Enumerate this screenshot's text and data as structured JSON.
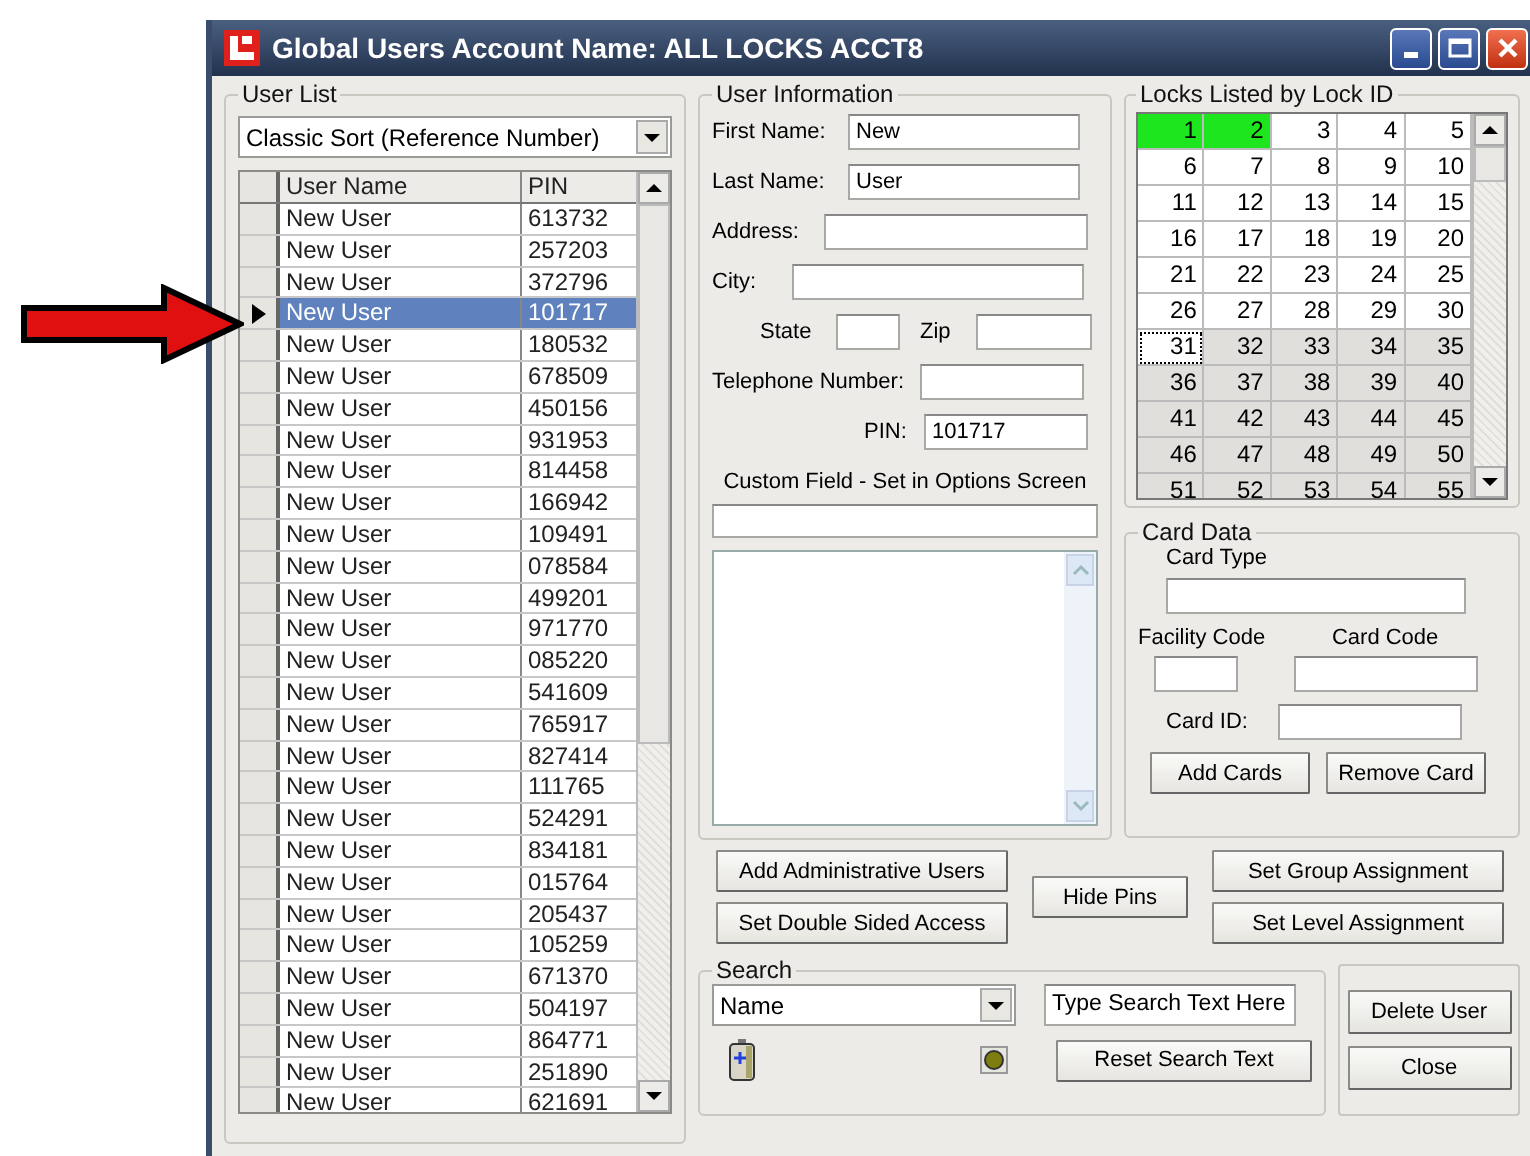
{
  "window": {
    "title": "Global Users Account Name: ALL LOCKS ACCT8"
  },
  "user_list": {
    "legend": "User List",
    "sort": "Classic Sort (Reference Number)",
    "columns": [
      "User Name",
      "PIN"
    ],
    "rows": [
      {
        "name": "New User",
        "pin": "613732",
        "selected": false
      },
      {
        "name": "New User",
        "pin": "257203",
        "selected": false
      },
      {
        "name": "New User",
        "pin": "372796",
        "selected": false
      },
      {
        "name": "New User",
        "pin": "101717",
        "selected": true
      },
      {
        "name": "New User",
        "pin": "180532",
        "selected": false
      },
      {
        "name": "New User",
        "pin": "678509",
        "selected": false
      },
      {
        "name": "New User",
        "pin": "450156",
        "selected": false
      },
      {
        "name": "New User",
        "pin": "931953",
        "selected": false
      },
      {
        "name": "New User",
        "pin": "814458",
        "selected": false
      },
      {
        "name": "New User",
        "pin": "166942",
        "selected": false
      },
      {
        "name": "New User",
        "pin": "109491",
        "selected": false
      },
      {
        "name": "New User",
        "pin": "078584",
        "selected": false
      },
      {
        "name": "New User",
        "pin": "499201",
        "selected": false
      },
      {
        "name": "New User",
        "pin": "971770",
        "selected": false
      },
      {
        "name": "New User",
        "pin": "085220",
        "selected": false
      },
      {
        "name": "New User",
        "pin": "541609",
        "selected": false
      },
      {
        "name": "New User",
        "pin": "765917",
        "selected": false
      },
      {
        "name": "New User",
        "pin": "827414",
        "selected": false
      },
      {
        "name": "New User",
        "pin": "111765",
        "selected": false
      },
      {
        "name": "New User",
        "pin": "524291",
        "selected": false
      },
      {
        "name": "New User",
        "pin": "834181",
        "selected": false
      },
      {
        "name": "New User",
        "pin": "015764",
        "selected": false
      },
      {
        "name": "New User",
        "pin": "205437",
        "selected": false
      },
      {
        "name": "New User",
        "pin": "105259",
        "selected": false
      },
      {
        "name": "New User",
        "pin": "671370",
        "selected": false
      },
      {
        "name": "New User",
        "pin": "504197",
        "selected": false
      },
      {
        "name": "New User",
        "pin": "864771",
        "selected": false
      },
      {
        "name": "New User",
        "pin": "251890",
        "selected": false
      },
      {
        "name": "New User",
        "pin": "621691",
        "selected": false
      }
    ]
  },
  "user_info": {
    "legend": "User Information",
    "first_name": {
      "label": "First Name:",
      "value": "New"
    },
    "last_name": {
      "label": "Last Name:",
      "value": "User"
    },
    "address": {
      "label": "Address:"
    },
    "city": {
      "label": "City:"
    },
    "state": {
      "label": "State"
    },
    "zip": {
      "label": "Zip"
    },
    "telephone": {
      "label": "Telephone Number:"
    },
    "pin": {
      "label": "PIN:",
      "value": "101717"
    },
    "custom_field": {
      "label": "Custom Field - Set in Options Screen"
    }
  },
  "locks": {
    "legend": "Locks Listed by Lock ID",
    "cells": [
      {
        "label": "1",
        "assigned": true,
        "available": true,
        "focused": false
      },
      {
        "label": "2",
        "assigned": true,
        "available": true,
        "focused": false
      },
      {
        "label": "3",
        "assigned": false,
        "available": true,
        "focused": false
      },
      {
        "label": "4",
        "assigned": false,
        "available": true,
        "focused": false
      },
      {
        "label": "5",
        "assigned": false,
        "available": true,
        "focused": false
      },
      {
        "label": "6",
        "assigned": false,
        "available": true,
        "focused": false
      },
      {
        "label": "7",
        "assigned": false,
        "available": true,
        "focused": false
      },
      {
        "label": "8",
        "assigned": false,
        "available": true,
        "focused": false
      },
      {
        "label": "9",
        "assigned": false,
        "available": true,
        "focused": false
      },
      {
        "label": "10",
        "assigned": false,
        "available": true,
        "focused": false
      },
      {
        "label": "11",
        "assigned": false,
        "available": true,
        "focused": false
      },
      {
        "label": "12",
        "assigned": false,
        "available": true,
        "focused": false
      },
      {
        "label": "13",
        "assigned": false,
        "available": true,
        "focused": false
      },
      {
        "label": "14",
        "assigned": false,
        "available": true,
        "focused": false
      },
      {
        "label": "15",
        "assigned": false,
        "available": true,
        "focused": false
      },
      {
        "label": "16",
        "assigned": false,
        "available": true,
        "focused": false
      },
      {
        "label": "17",
        "assigned": false,
        "available": true,
        "focused": false
      },
      {
        "label": "18",
        "assigned": false,
        "available": true,
        "focused": false
      },
      {
        "label": "19",
        "assigned": false,
        "available": true,
        "focused": false
      },
      {
        "label": "20",
        "assigned": false,
        "available": true,
        "focused": false
      },
      {
        "label": "21",
        "assigned": false,
        "available": true,
        "focused": false
      },
      {
        "label": "22",
        "assigned": false,
        "available": true,
        "focused": false
      },
      {
        "label": "23",
        "assigned": false,
        "available": true,
        "focused": false
      },
      {
        "label": "24",
        "assigned": false,
        "available": true,
        "focused": false
      },
      {
        "label": "25",
        "assigned": false,
        "available": true,
        "focused": false
      },
      {
        "label": "26",
        "assigned": false,
        "available": true,
        "focused": false
      },
      {
        "label": "27",
        "assigned": false,
        "available": true,
        "focused": false
      },
      {
        "label": "28",
        "assigned": false,
        "available": true,
        "focused": false
      },
      {
        "label": "29",
        "assigned": false,
        "available": true,
        "focused": false
      },
      {
        "label": "30",
        "assigned": false,
        "available": true,
        "focused": false
      },
      {
        "label": "31",
        "assigned": false,
        "available": true,
        "focused": true
      },
      {
        "label": "32",
        "assigned": false,
        "available": false,
        "focused": false
      },
      {
        "label": "33",
        "assigned": false,
        "available": false,
        "focused": false
      },
      {
        "label": "34",
        "assigned": false,
        "available": false,
        "focused": false
      },
      {
        "label": "35",
        "assigned": false,
        "available": false,
        "focused": false
      },
      {
        "label": "36",
        "assigned": false,
        "available": false,
        "focused": false
      },
      {
        "label": "37",
        "assigned": false,
        "available": false,
        "focused": false
      },
      {
        "label": "38",
        "assigned": false,
        "available": false,
        "focused": false
      },
      {
        "label": "39",
        "assigned": false,
        "available": false,
        "focused": false
      },
      {
        "label": "40",
        "assigned": false,
        "available": false,
        "focused": false
      },
      {
        "label": "41",
        "assigned": false,
        "available": false,
        "focused": false
      },
      {
        "label": "42",
        "assigned": false,
        "available": false,
        "focused": false
      },
      {
        "label": "43",
        "assigned": false,
        "available": false,
        "focused": false
      },
      {
        "label": "44",
        "assigned": false,
        "available": false,
        "focused": false
      },
      {
        "label": "45",
        "assigned": false,
        "available": false,
        "focused": false
      },
      {
        "label": "46",
        "assigned": false,
        "available": false,
        "focused": false
      },
      {
        "label": "47",
        "assigned": false,
        "available": false,
        "focused": false
      },
      {
        "label": "48",
        "assigned": false,
        "available": false,
        "focused": false
      },
      {
        "label": "49",
        "assigned": false,
        "available": false,
        "focused": false
      },
      {
        "label": "50",
        "assigned": false,
        "available": false,
        "focused": false
      },
      {
        "label": "51",
        "assigned": false,
        "available": false,
        "focused": false
      },
      {
        "label": "52",
        "assigned": false,
        "available": false,
        "focused": false
      },
      {
        "label": "53",
        "assigned": false,
        "available": false,
        "focused": false
      },
      {
        "label": "54",
        "assigned": false,
        "available": false,
        "focused": false
      },
      {
        "label": "55",
        "assigned": false,
        "available": false,
        "focused": false
      }
    ]
  },
  "card_data": {
    "legend": "Card Data",
    "card_type_label": "Card Type",
    "facility_code_label": "Facility Code",
    "card_code_label": "Card Code",
    "card_id_label": "Card ID:",
    "buttons": [
      "Add Cards",
      "Remove Card"
    ]
  },
  "actions": {
    "left": [
      "Add Administrative Users",
      "Set Double Sided Access"
    ],
    "middle": "Hide Pins",
    "right": [
      "Set Group Assignment",
      "Set Level Assignment"
    ]
  },
  "search": {
    "legend": "Search",
    "field": "Name",
    "value": "Type Search Text Here",
    "reset": "Reset Search Text"
  },
  "side_buttons": [
    "Delete User",
    "Close"
  ]
}
